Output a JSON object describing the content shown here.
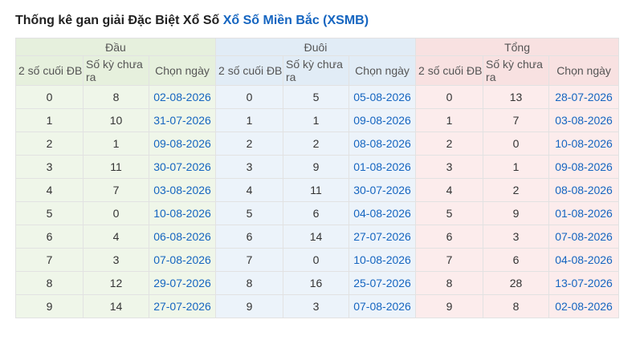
{
  "heading": {
    "prefix": "Thống kê gan giải Đặc Biệt Xổ Số ",
    "link": "Xổ Số Miền Bắc (XSMB)"
  },
  "table": {
    "groups": [
      "Đầu",
      "Đuôi",
      "Tổng"
    ],
    "subheaders": [
      "2 số cuối ĐB",
      "Số kỳ chưa ra",
      "Chọn ngày"
    ],
    "rows": [
      [
        [
          "0",
          "8",
          "02-08-2026"
        ],
        [
          "0",
          "5",
          "05-08-2026"
        ],
        [
          "0",
          "13",
          "28-07-2026"
        ]
      ],
      [
        [
          "1",
          "10",
          "31-07-2026"
        ],
        [
          "1",
          "1",
          "09-08-2026"
        ],
        [
          "1",
          "7",
          "03-08-2026"
        ]
      ],
      [
        [
          "2",
          "1",
          "09-08-2026"
        ],
        [
          "2",
          "2",
          "08-08-2026"
        ],
        [
          "2",
          "0",
          "10-08-2026"
        ]
      ],
      [
        [
          "3",
          "11",
          "30-07-2026"
        ],
        [
          "3",
          "9",
          "01-08-2026"
        ],
        [
          "3",
          "1",
          "09-08-2026"
        ]
      ],
      [
        [
          "4",
          "7",
          "03-08-2026"
        ],
        [
          "4",
          "11",
          "30-07-2026"
        ],
        [
          "4",
          "2",
          "08-08-2026"
        ]
      ],
      [
        [
          "5",
          "0",
          "10-08-2026"
        ],
        [
          "5",
          "6",
          "04-08-2026"
        ],
        [
          "5",
          "9",
          "01-08-2026"
        ]
      ],
      [
        [
          "6",
          "4",
          "06-08-2026"
        ],
        [
          "6",
          "14",
          "27-07-2026"
        ],
        [
          "6",
          "3",
          "07-08-2026"
        ]
      ],
      [
        [
          "7",
          "3",
          "07-08-2026"
        ],
        [
          "7",
          "0",
          "10-08-2026"
        ],
        [
          "7",
          "6",
          "04-08-2026"
        ]
      ],
      [
        [
          "8",
          "12",
          "29-07-2026"
        ],
        [
          "8",
          "16",
          "25-07-2026"
        ],
        [
          "8",
          "28",
          "13-07-2026"
        ]
      ],
      [
        [
          "9",
          "14",
          "27-07-2026"
        ],
        [
          "9",
          "3",
          "07-08-2026"
        ],
        [
          "9",
          "8",
          "02-08-2026"
        ]
      ]
    ]
  }
}
